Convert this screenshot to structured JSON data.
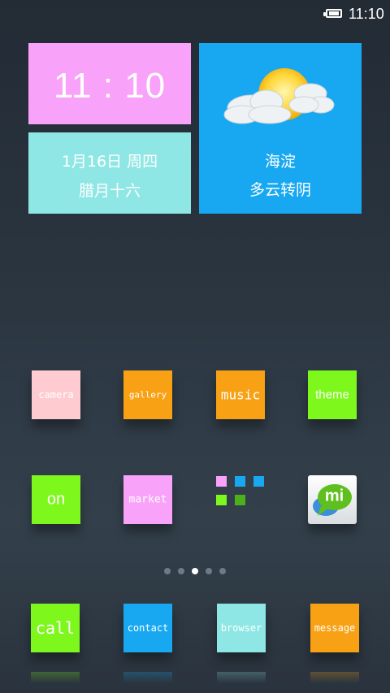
{
  "status_bar": {
    "time": "11:10",
    "battery_icon": "battery-full-icon"
  },
  "widgets": {
    "clock": {
      "time": "11 : 10",
      "color": "#f9a2f9"
    },
    "date": {
      "line1": "1月16日 周四",
      "line2": "腊月十六",
      "color": "#8fe7e5"
    },
    "weather": {
      "city": "海淀",
      "condition": "多云转阴",
      "icon": "partly-cloudy-icon",
      "color": "#18a8f1"
    }
  },
  "apps_row1": [
    {
      "label": "camera",
      "color": "#fecbd0"
    },
    {
      "label": "gallery",
      "color": "#f8a115"
    },
    {
      "label": "music",
      "color": "#f8a115"
    },
    {
      "label": "theme",
      "color": "#7ef81c"
    }
  ],
  "apps_row2": [
    {
      "label": "on",
      "color": "#7ef81c"
    },
    {
      "label": "market",
      "color": "#f9a2f9"
    },
    {
      "label": "",
      "icon": "folder-icon"
    },
    {
      "label": "",
      "icon": "mi-talk-icon"
    }
  ],
  "folder_minis": [
    {
      "color": "#f9a2f9"
    },
    {
      "color": "#18a8f1"
    },
    {
      "color": "#18a8f1"
    },
    {
      "color": "#7ef81c"
    },
    {
      "color": "#4caf1c"
    }
  ],
  "mi_icon_text": "mi",
  "page_indicator": {
    "count": 5,
    "active_index": 2
  },
  "dock": [
    {
      "label": "call",
      "color": "#7ef81c"
    },
    {
      "label": "contact",
      "color": "#18a8f1"
    },
    {
      "label": "browser",
      "color": "#8fe7e5"
    },
    {
      "label": "message",
      "color": "#f8a115"
    }
  ]
}
